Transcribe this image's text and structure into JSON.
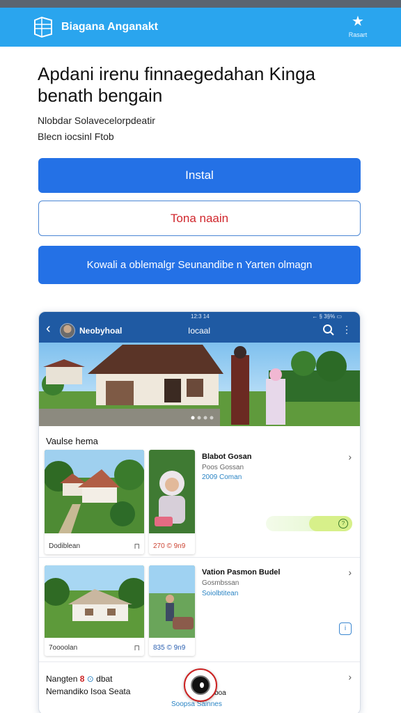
{
  "app_bar": {
    "name": "Biagana Anganakt",
    "favorite_label": "Rasart"
  },
  "main": {
    "headline_line1": "Apdani irenu finnaegedahan Kinga",
    "headline_line2": "benath bengain",
    "subline1": "Nlobdar Solavecelorpdeatir",
    "subline2": "Blecn iocsinl Ftob",
    "install_label": "Instal",
    "secondary_label": "Tona naain",
    "cta_label": "Kowali a oblemalgr Seunandibe n Yarten olmagn"
  },
  "preview": {
    "status_time": "12:3 14",
    "status_right": "← § 3§% ▭",
    "profile_name": "Neobyhoal",
    "center_label": "Iocaal",
    "section_title": "Vaulse hema",
    "items": [
      {
        "title": "Blabot Gosan",
        "subtitle": "Poos Gossan",
        "link": "2009 Coman",
        "thumb_caption_left": "Dodiblean",
        "thumb_caption_right": "270 © 9n9",
        "progress": 0.5
      },
      {
        "title": "Vation Pasmon Budel",
        "subtitle": "Gosmbssan",
        "link": "Soiolbtitean",
        "thumb_caption_left": "7oooolan",
        "thumb_caption_right": "835 © 9n9"
      }
    ],
    "bottom_line1": "Nangten",
    "bottom_badge": "8",
    "bottom_suffix": "dbat",
    "bottom_line2": "Nemandiko Isoa Seata",
    "bottom_tail": "boa",
    "bottom_link": "Soopsa Sainnes"
  },
  "colors": {
    "app_bar": "#2aa5ee",
    "primary": "#2471e6",
    "danger_text": "#d0262c",
    "phone_header": "#1f5aa3"
  }
}
